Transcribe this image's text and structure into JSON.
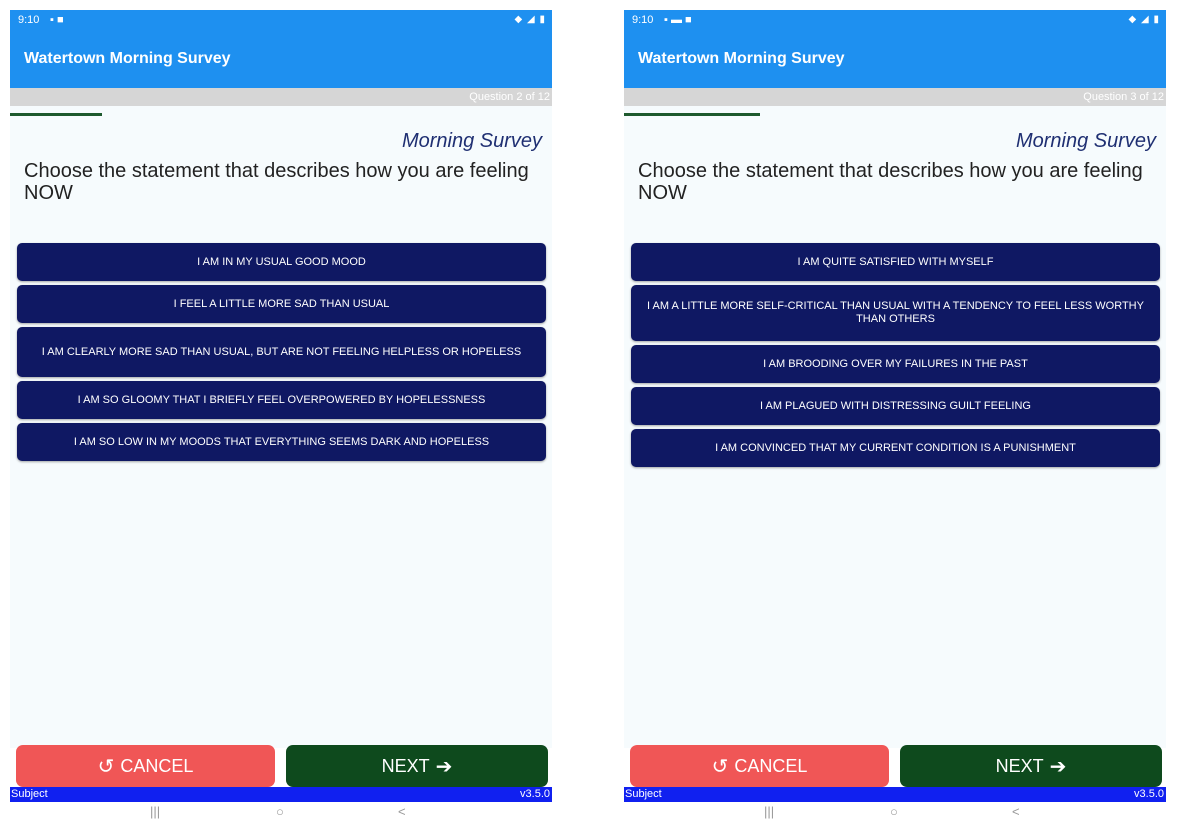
{
  "screens": [
    {
      "status": {
        "time": "9:10",
        "icons": "▪ ■",
        "right_icons": "◆ ◢ ▮"
      },
      "app_title": "Watertown Morning Survey",
      "progress": {
        "label": "Question 2 of 12",
        "fraction": 0.17
      },
      "survey_name": "Morning Survey",
      "question": "Choose the statement that describes how you are feeling NOW",
      "options": [
        "I AM IN MY USUAL GOOD MOOD",
        "I FEEL A LITTLE MORE SAD THAN USUAL",
        "I AM CLEARLY MORE SAD THAN USUAL, BUT ARE NOT FEELING HELPLESS OR HOPELESS",
        "I AM SO GLOOMY THAT I BRIEFLY FEEL OVERPOWERED BY HOPELESSNESS",
        "I AM SO LOW IN MY MOODS THAT EVERYTHING SEEMS DARK AND HOPELESS"
      ],
      "buttons": {
        "cancel": "CANCEL",
        "next": "NEXT"
      },
      "footer": {
        "left": "Subject",
        "right": "v3.5.0"
      },
      "nav": {
        "recents": "|||",
        "home": "○",
        "back": "<"
      }
    },
    {
      "status": {
        "time": "9:10",
        "icons": "▪ ▬ ■",
        "right_icons": "◆ ◢ ▮"
      },
      "app_title": "Watertown Morning Survey",
      "progress": {
        "label": "Question 3 of 12",
        "fraction": 0.25
      },
      "survey_name": "Morning Survey",
      "question": "Choose the statement that describes how you are feeling NOW",
      "options": [
        "I AM QUITE SATISFIED WITH MYSELF",
        "I AM A LITTLE MORE SELF-CRITICAL THAN USUAL WITH A TENDENCY TO FEEL LESS WORTHY THAN OTHERS",
        "I AM BROODING OVER MY FAILURES IN THE PAST",
        "I AM PLAGUED WITH DISTRESSING GUILT FEELING",
        "I AM CONVINCED THAT MY CURRENT CONDITION IS A PUNISHMENT"
      ],
      "buttons": {
        "cancel": "CANCEL",
        "next": "NEXT"
      },
      "footer": {
        "left": "Subject",
        "right": "v3.5.0"
      },
      "nav": {
        "recents": "|||",
        "home": "○",
        "back": "<"
      }
    }
  ],
  "colors": {
    "appbar": "#1e90f0",
    "option": "#0f1863",
    "cancel": "#f05656",
    "next": "#0e4a1d",
    "footer": "#1020f0"
  }
}
